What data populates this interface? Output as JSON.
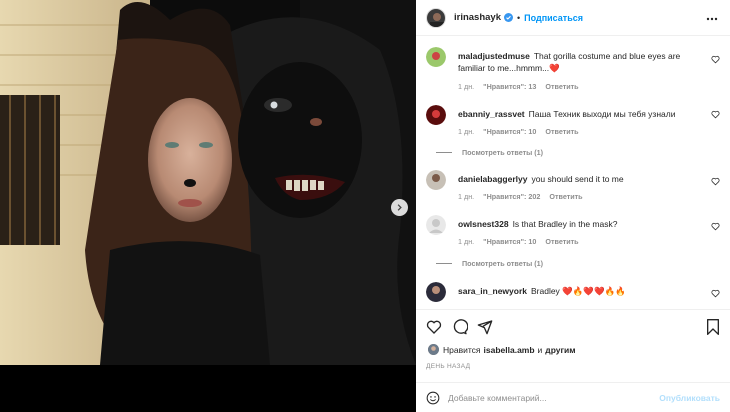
{
  "header": {
    "username": "irinashayk",
    "separator": "•",
    "follow_label": "Подписаться"
  },
  "comments": [
    {
      "username": "maladjustedmuse",
      "text": "That gorilla costume and blue eyes are familiar to me...hmmm...",
      "emoji": "❤️",
      "time": "1 дн.",
      "likes": "\"Нравится\": 13",
      "reply": "Ответить",
      "view_replies": ""
    },
    {
      "username": "ebanniy_rassvet",
      "text": "Паша Техник выходи мы тебя узнали",
      "emoji": "",
      "time": "1 дн.",
      "likes": "\"Нравится\": 10",
      "reply": "Ответить",
      "view_replies": "Посмотреть ответы (1)"
    },
    {
      "username": "danielabaggerlyy",
      "text": "you should send it to me",
      "emoji": "",
      "time": "1 дн.",
      "likes": "\"Нравится\": 202",
      "reply": "Ответить",
      "view_replies": ""
    },
    {
      "username": "owlsnest328",
      "text": "Is that Bradley in the mask?",
      "emoji": "",
      "time": "1 дн.",
      "likes": "\"Нравится\": 10",
      "reply": "Ответить",
      "view_replies": "Посмотреть ответы (1)"
    },
    {
      "username": "sara_in_newyork",
      "text": "Bradley",
      "emoji": "❤️🔥❤️❤️🔥🔥",
      "time": "",
      "likes": "",
      "reply": "",
      "view_replies": ""
    }
  ],
  "likes_line": {
    "prefix": "Нравится",
    "user": "isabella.amb",
    "middle": "и",
    "others": "другим"
  },
  "date": "ДЕНЬ НАЗАД",
  "add_comment": {
    "placeholder": "Добавьте комментарий...",
    "publish_label": "Опубликовать"
  },
  "colors": {
    "accent": "#0095f6",
    "publish_disabled": "#b2dffc",
    "heart_red": "#ed4956"
  }
}
